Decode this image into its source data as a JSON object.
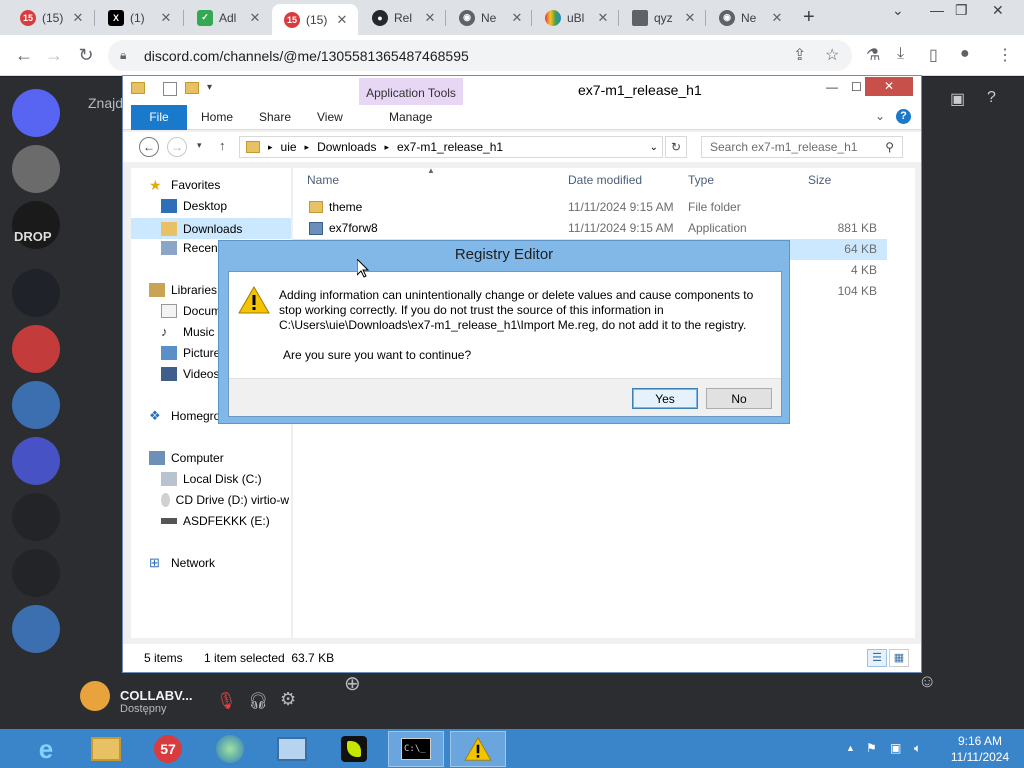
{
  "browser": {
    "tabs": [
      {
        "label": "(15)",
        "icon": "discord-badge-icon",
        "color": "#d83c3e"
      },
      {
        "label": "(1)",
        "icon": "x-icon",
        "color": "#000000"
      },
      {
        "label": "Adl",
        "icon": "shield-check-icon",
        "color": "#34a853"
      },
      {
        "label": "(15)",
        "icon": "discord-badge-icon",
        "color": "#d83c3e"
      },
      {
        "label": "Rel",
        "icon": "github-icon",
        "color": "#24292e"
      },
      {
        "label": "Ne",
        "icon": "chrome-icon",
        "color": "#5f6368"
      },
      {
        "label": "uBl",
        "icon": "rainbow-icon",
        "color": "#e37400"
      },
      {
        "label": "qyz",
        "icon": "square-icon",
        "color": "#5f6368"
      },
      {
        "label": "Ne",
        "icon": "chrome-icon",
        "color": "#5f6368"
      }
    ],
    "url": "discord.com/channels/@me/1305581365487468595"
  },
  "discord": {
    "search_hint": "Znajdź",
    "collab_name": "COLLABV...",
    "collab_sub": "Dostępny",
    "drop_label": "DROP"
  },
  "explorer": {
    "title": "ex7-m1_release_h1",
    "app_tools": "Application Tools",
    "ribbon_tabs": [
      "File",
      "Home",
      "Share",
      "View",
      "Manage"
    ],
    "breadcrumb": [
      "uie",
      "Downloads",
      "ex7-m1_release_h1"
    ],
    "search_placeholder": "Search ex7-m1_release_h1",
    "columns": {
      "name": "Name",
      "date": "Date modified",
      "type": "Type",
      "size": "Size"
    },
    "files": [
      {
        "name": "theme",
        "date": "11/11/2024 9:15 AM",
        "type": "File folder",
        "size": ""
      },
      {
        "name": "ex7forw8",
        "date": "11/11/2024 9:15 AM",
        "type": "Application",
        "size": "881 KB"
      },
      {
        "name": "",
        "date": "",
        "type": "",
        "size": "64 KB"
      },
      {
        "name": "",
        "date": "",
        "type": "",
        "size": "4 KB"
      },
      {
        "name": "",
        "date": "",
        "type": "",
        "size": "104 KB"
      }
    ],
    "nav": {
      "favorites": "Favorites",
      "desktop": "Desktop",
      "downloads": "Downloads",
      "recent": "Recent",
      "libraries": "Libraries",
      "documents": "Docum",
      "music": "Music",
      "pictures": "Picture",
      "videos": "Videos",
      "homegroup": "Homegro",
      "computer": "Computer",
      "local_disk": "Local Disk (C:)",
      "cd_drive": "CD Drive (D:) virtio-w",
      "usb": "ASDFEKKK (E:)",
      "network": "Network"
    },
    "status": {
      "items": "5 items",
      "selected": "1 item selected  63.7 KB"
    }
  },
  "dialog": {
    "title": "Registry Editor",
    "message": "Adding information can unintentionally change or delete values and cause components to stop working correctly. If you do not trust the source of this information in C:\\Users\\uie\\Downloads\\ex7-m1_release_h1\\Import Me.reg, do not add it to the registry.",
    "question": "Are you sure you want to continue?",
    "yes": "Yes",
    "no": "No"
  },
  "taskbar": {
    "time": "9:16 AM",
    "date": "11/11/2024",
    "chrome_badge": "57"
  }
}
